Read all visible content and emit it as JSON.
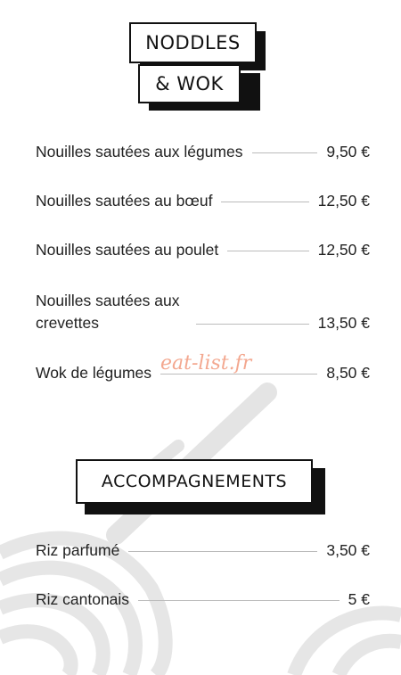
{
  "section1": {
    "title_line1": "NODDLES",
    "title_line2": "& WOK",
    "items": [
      {
        "name": "Nouilles sautées aux légumes",
        "price": "9,50 €"
      },
      {
        "name": "Nouilles sautées au bœuf",
        "price": "12,50 €"
      },
      {
        "name": "Nouilles sautées au poulet",
        "price": "12,50 €"
      },
      {
        "name": "Nouilles sautées aux crevettes",
        "price": "13,50 €"
      },
      {
        "name": "Wok de légumes",
        "price": "8,50 €"
      }
    ]
  },
  "section2": {
    "title": "ACCOMPAGNEMENTS",
    "items": [
      {
        "name": "Riz parfumé",
        "price": "3,50 €"
      },
      {
        "name": "Riz cantonais",
        "price": "5 €"
      }
    ]
  },
  "watermark": "eat-list.fr",
  "colors": {
    "text": "#222222",
    "frame": "#111111",
    "watermark": "#f08c6c",
    "background_art": "#e6e6e6"
  }
}
